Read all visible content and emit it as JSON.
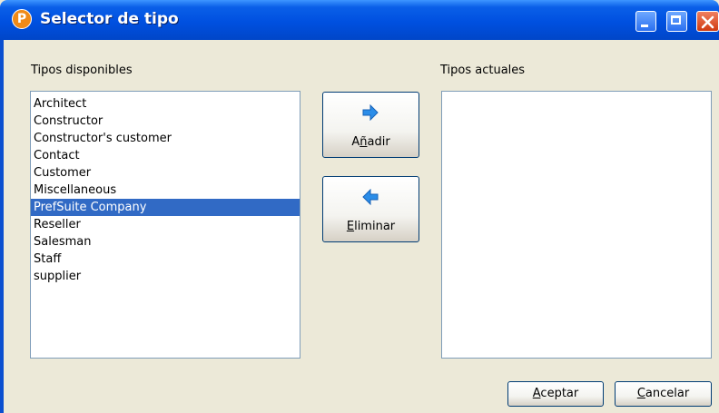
{
  "window": {
    "title": "Selector de tipo",
    "app_icon_letter": "P",
    "controls": [
      "minimize-icon",
      "maximize-icon",
      "close-icon"
    ]
  },
  "available": {
    "label": "Tipos disponibles",
    "items": [
      "Architect",
      "Constructor",
      "Constructor's customer",
      "Contact",
      "Customer",
      "Miscellaneous",
      "PrefSuite Company",
      "Reseller",
      "Salesman",
      "Staff",
      "supplier"
    ],
    "selected": "PrefSuite Company"
  },
  "current": {
    "label": "Tipos actuales",
    "items": []
  },
  "buttons": {
    "add_label": "Añadir",
    "remove_label": "Eliminar",
    "accept_label": "Aceptar",
    "cancel_label": "Cancelar"
  },
  "colors": {
    "title_bar": "#0050e0",
    "selection": "#316ac5",
    "arrow": "#2b8de8",
    "dialog_bg": "#ece9d8"
  }
}
